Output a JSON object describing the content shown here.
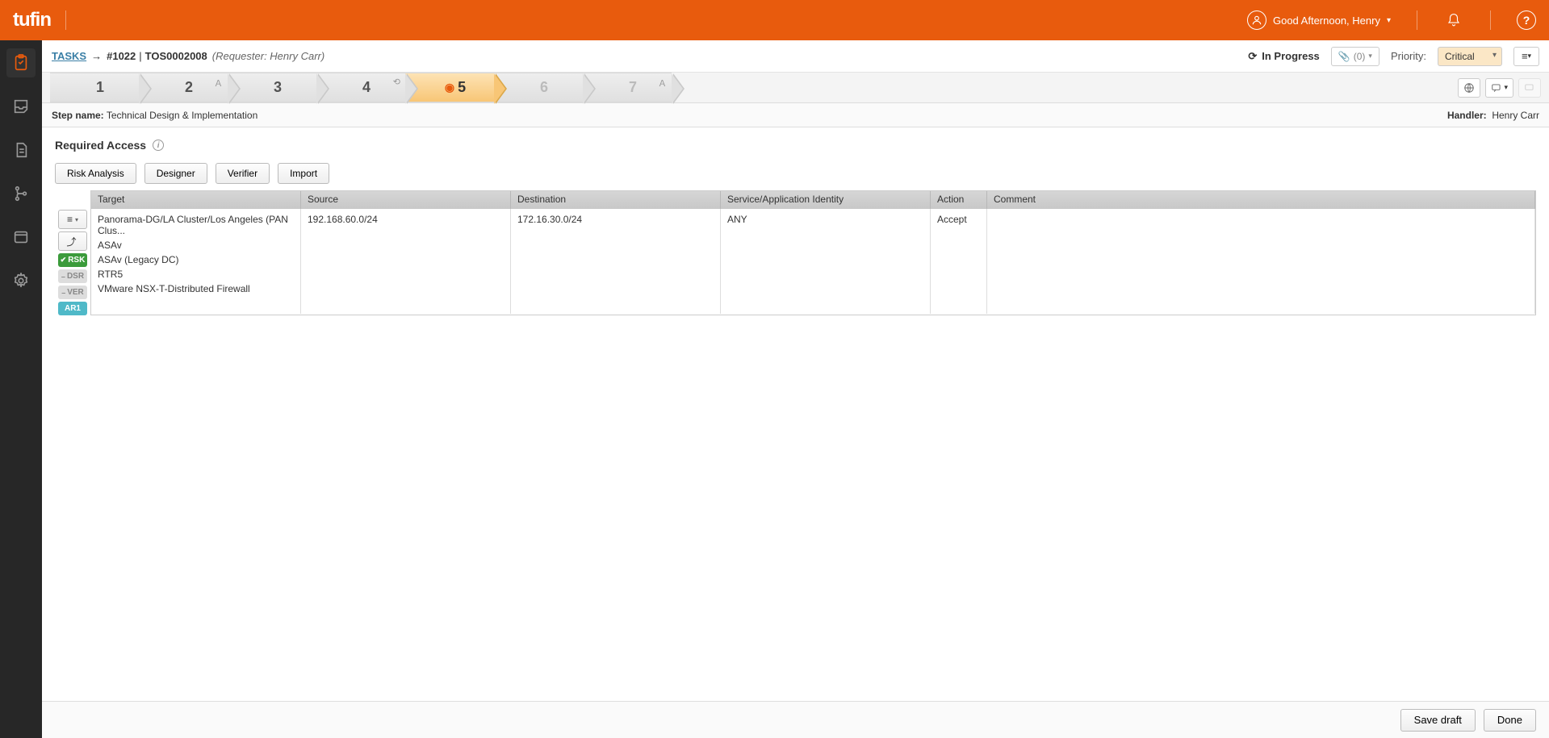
{
  "brand": "tufin",
  "user_greeting": "Good Afternoon, Henry",
  "breadcrumb": {
    "link": "TASKS",
    "ticket_num": "#1022",
    "separator": "|",
    "title": "TOS0002008",
    "requester_label": "(Requester: Henry Carr)"
  },
  "status": "In Progress",
  "attach_count": "(0)",
  "priority_label": "Priority:",
  "priority_value": "Critical",
  "workflow": {
    "steps": [
      "1",
      "2",
      "3",
      "4",
      "5",
      "6",
      "7"
    ],
    "current": 5
  },
  "step_meta": {
    "name_label": "Step name:",
    "name_value": "Technical Design & Implementation",
    "handler_label": "Handler:",
    "handler_value": "Henry Carr"
  },
  "section_title": "Required Access",
  "action_buttons": {
    "risk": "Risk Analysis",
    "designer": "Designer",
    "verifier": "Verifier",
    "import": "Import"
  },
  "side_badges": {
    "rsk": "RSK",
    "dsr": "DSR",
    "ver": "VER",
    "ar1": "AR1"
  },
  "table": {
    "headers": {
      "target": "Target",
      "source": "Source",
      "destination": "Destination",
      "service": "Service/Application Identity",
      "action": "Action",
      "comment": "Comment"
    },
    "row": {
      "targets": [
        "Panorama-DG/LA Cluster/Los Angeles (PAN Clus...",
        "ASAv",
        "ASAv (Legacy DC)",
        "RTR5",
        "VMware NSX-T-Distributed Firewall"
      ],
      "source": "192.168.60.0/24",
      "destination": "172.16.30.0/24",
      "service": "ANY",
      "action": "Accept",
      "comment": ""
    }
  },
  "footer": {
    "save": "Save draft",
    "done": "Done"
  }
}
